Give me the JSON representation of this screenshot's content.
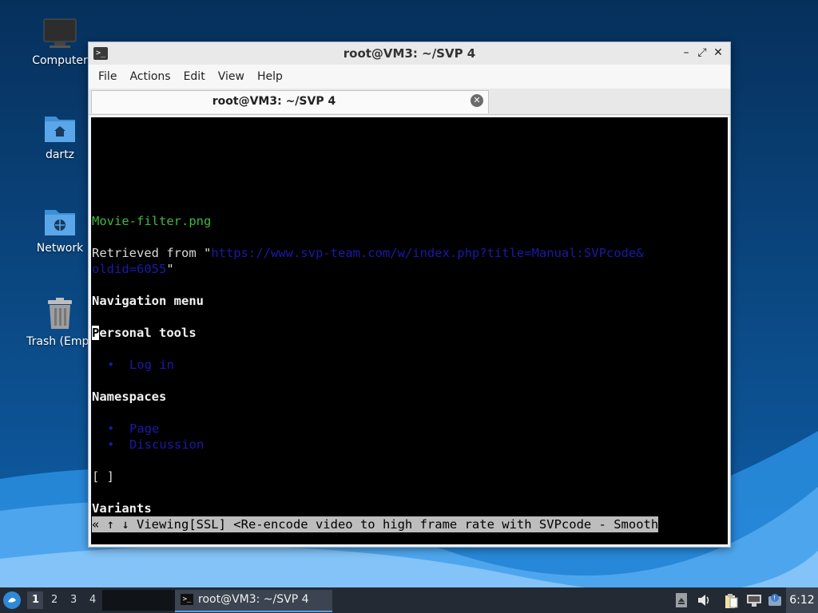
{
  "desktop": {
    "icons": [
      {
        "label": "Computer"
      },
      {
        "label": "dartz"
      },
      {
        "label": "Network"
      },
      {
        "label": "Trash (Empt"
      }
    ]
  },
  "window": {
    "title": "root@VM3: ~/SVP 4",
    "menu": [
      "File",
      "Actions",
      "Edit",
      "View",
      "Help"
    ],
    "tab_label": "root@VM3: ~/SVP 4"
  },
  "terminal": {
    "file_link": "Movie-filter.png",
    "retrieved_prefix": "Retrieved from \"",
    "retrieved_url_1": "https://www.svp-team.com/w/index.php?title=Manual:SVPcode&",
    "retrieved_url_2": "oldid=6055",
    "retrieved_suffix": "\"",
    "nav_menu": "Navigation menu",
    "personal_tools_first": "P",
    "personal_tools_rest": "ersonal tools",
    "bullet": "•",
    "log_in": "Log in",
    "namespaces": "Namespaces",
    "page": "Page",
    "discussion": "Discussion",
    "brackets": "[ ]",
    "variants": "Variants",
    "status_line": "« ↑ ↓ Viewing[SSL] <Re-encode video to high frame rate with SVPcode - Smooth"
  },
  "taskbar": {
    "workspaces": [
      "1",
      "2",
      "3",
      "4"
    ],
    "task_label": "root@VM3: ~/SVP 4",
    "clock": "6:12"
  }
}
